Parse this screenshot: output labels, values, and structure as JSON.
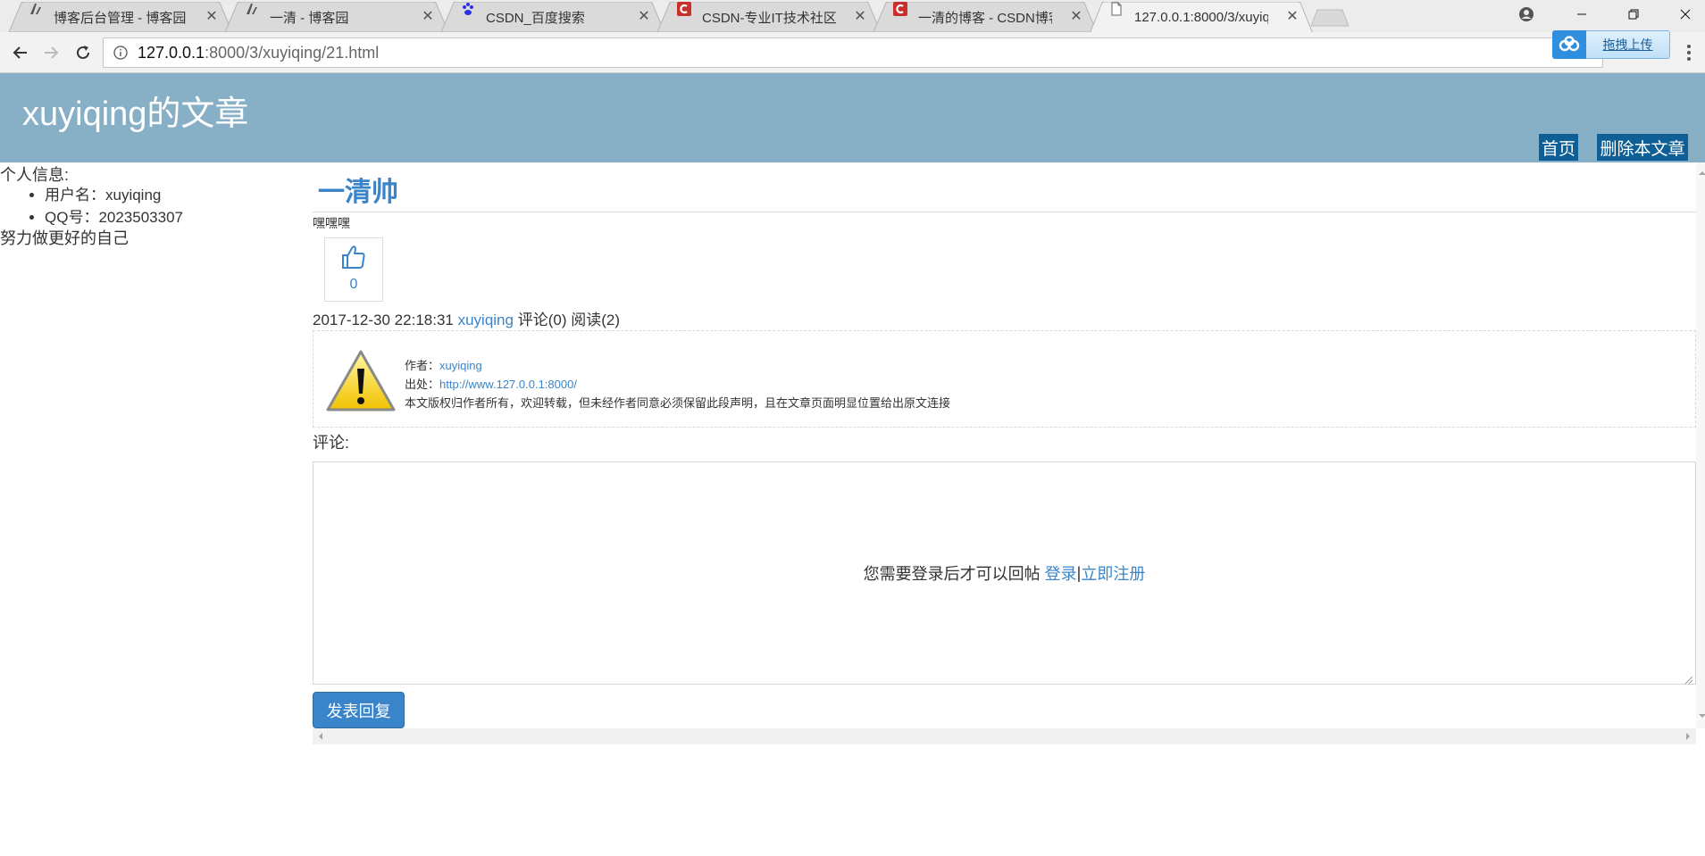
{
  "browser": {
    "tabs": [
      {
        "title": "博客后台管理 - 博客园",
        "favicon": "cnblogs-icon",
        "active": false
      },
      {
        "title": "一清 - 博客园",
        "favicon": "cnblogs-icon",
        "active": false
      },
      {
        "title": "CSDN_百度搜索",
        "favicon": "baidu-paw-icon",
        "active": false
      },
      {
        "title": "CSDN-专业IT技术社区",
        "favicon": "csdn-icon",
        "active": false
      },
      {
        "title": "一清的博客 - CSDN博客",
        "favicon": "csdn-icon",
        "active": false
      },
      {
        "title": "127.0.0.1:8000/3/xuyiq",
        "favicon": "page-icon",
        "active": true
      }
    ],
    "url_host": "127.0.0.1",
    "url_path": ":8000/3/xuyiqing/21.html",
    "upload_widget_label": "拖拽上传",
    "colors": {
      "csdn_red": "#c9302c",
      "baidu_blue": "#2932e1",
      "upload_blue": "#2f8fde"
    }
  },
  "site": {
    "title": "xuyiqing的文章",
    "nav": {
      "home": "首页",
      "delete_article": "删除本文章"
    },
    "colors": {
      "banner": "#87afc5",
      "nav_button": "#0e5f95",
      "link": "#3a85c9"
    }
  },
  "sidebar": {
    "info_heading": "个人信息:",
    "items": [
      {
        "label": "用户名：xuyiqing"
      },
      {
        "label": "QQ号：2023503307"
      }
    ],
    "motto": "努力做更好的自己"
  },
  "article": {
    "title": "一清帅",
    "body": "嘿嘿嘿",
    "like_count": "0",
    "meta": {
      "datetime": "2017-12-30 22:18:31",
      "author": "xuyiqing",
      "comments": "评论(0)",
      "reads": "阅读(2)"
    },
    "copyright": {
      "author_label": "作者：",
      "author": "xuyiqing",
      "source_label": "出处：",
      "source_url": "http://www.127.0.0.1:8000/",
      "notice": "本文版权归作者所有，欢迎转载，但未经作者同意必须保留此段声明，且在文章页面明显位置给出原文连接"
    }
  },
  "comments": {
    "heading": "评论:",
    "login_prompt": "您需要登录后才可以回帖",
    "login_link": "登录",
    "separator": " | ",
    "register_link": "立即注册",
    "submit_label": "发表回复"
  }
}
